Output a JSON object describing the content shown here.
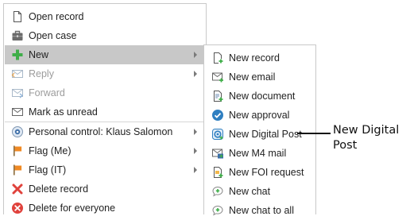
{
  "main_menu": {
    "items": [
      {
        "label": "Open record",
        "icon": "document-icon"
      },
      {
        "label": "Open case",
        "icon": "briefcase-icon"
      },
      {
        "label": "New",
        "icon": "plus-icon",
        "has_submenu": true,
        "highlighted": true
      },
      {
        "label": "Reply",
        "icon": "reply-icon",
        "has_submenu": true,
        "disabled": true
      },
      {
        "label": "Forward",
        "icon": "forward-icon",
        "disabled": true
      },
      {
        "label": "Mark as unread",
        "icon": "envelope-icon"
      },
      {
        "label": "Personal control: Klaus Salomon",
        "icon": "eye-icon",
        "has_submenu": true
      },
      {
        "label": "Flag (Me)",
        "icon": "flag-icon",
        "has_submenu": true
      },
      {
        "label": "Flag (IT)",
        "icon": "flag-icon",
        "has_submenu": true
      },
      {
        "label": "Delete record",
        "icon": "delete-x-icon"
      },
      {
        "label": "Delete for everyone",
        "icon": "delete-circle-icon"
      }
    ]
  },
  "new_submenu": {
    "items": [
      {
        "label": "New record",
        "icon": "new-record-icon"
      },
      {
        "label": "New email",
        "icon": "new-email-icon"
      },
      {
        "label": "New document",
        "icon": "new-document-icon"
      },
      {
        "label": "New approval",
        "icon": "approval-icon"
      },
      {
        "label": "New Digital Post",
        "icon": "digital-post-icon"
      },
      {
        "label": "New M4 mail",
        "icon": "m4-mail-icon"
      },
      {
        "label": "New FOI request",
        "icon": "foi-request-icon"
      },
      {
        "label": "New chat",
        "icon": "chat-icon"
      },
      {
        "label": "New chat to all",
        "icon": "chat-all-icon"
      }
    ]
  },
  "callout": {
    "text": "New Digital Post"
  },
  "colors": {
    "highlight": "#c8c8c8",
    "border": "#c9c9c9",
    "disabled_text": "#9c9c9c",
    "plus_green": "#3fae49",
    "delete_red": "#e0423c",
    "flag_orange": "#f08a24",
    "approval_blue": "#2f7fc1"
  }
}
